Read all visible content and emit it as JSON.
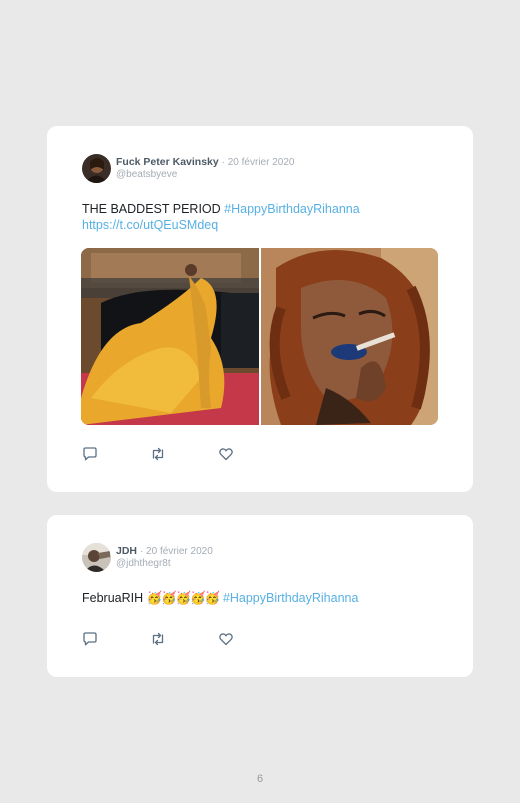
{
  "tweets": [
    {
      "display_name": "Fuck Peter Kavinsky",
      "date": "· 20 février 2020",
      "handle": "@beatsbyeve",
      "text": "THE BADDEST PERIOD ",
      "hashtag": "#HappyBirthdayRihanna",
      "url": "https://t.co/utQEuSMdeq",
      "actions": [
        "reply-icon",
        "retweet-icon",
        "like-icon"
      ]
    },
    {
      "display_name": "JDH",
      "date": "· 20 février 2020",
      "handle": "@jdhthegr8t",
      "text": "FebruaRIH ",
      "emoji": "🥳🥳🥳🥳🥳",
      "hashtag": "#HappyBirthdayRihanna",
      "actions": [
        "reply-icon",
        "retweet-icon",
        "like-icon"
      ]
    }
  ],
  "page_number": "6",
  "colors": {
    "background": "#e9e9e9",
    "card": "#ffffff",
    "link": "#57b0e4",
    "name": "#4d5a66",
    "meta": "#a4acb4"
  }
}
